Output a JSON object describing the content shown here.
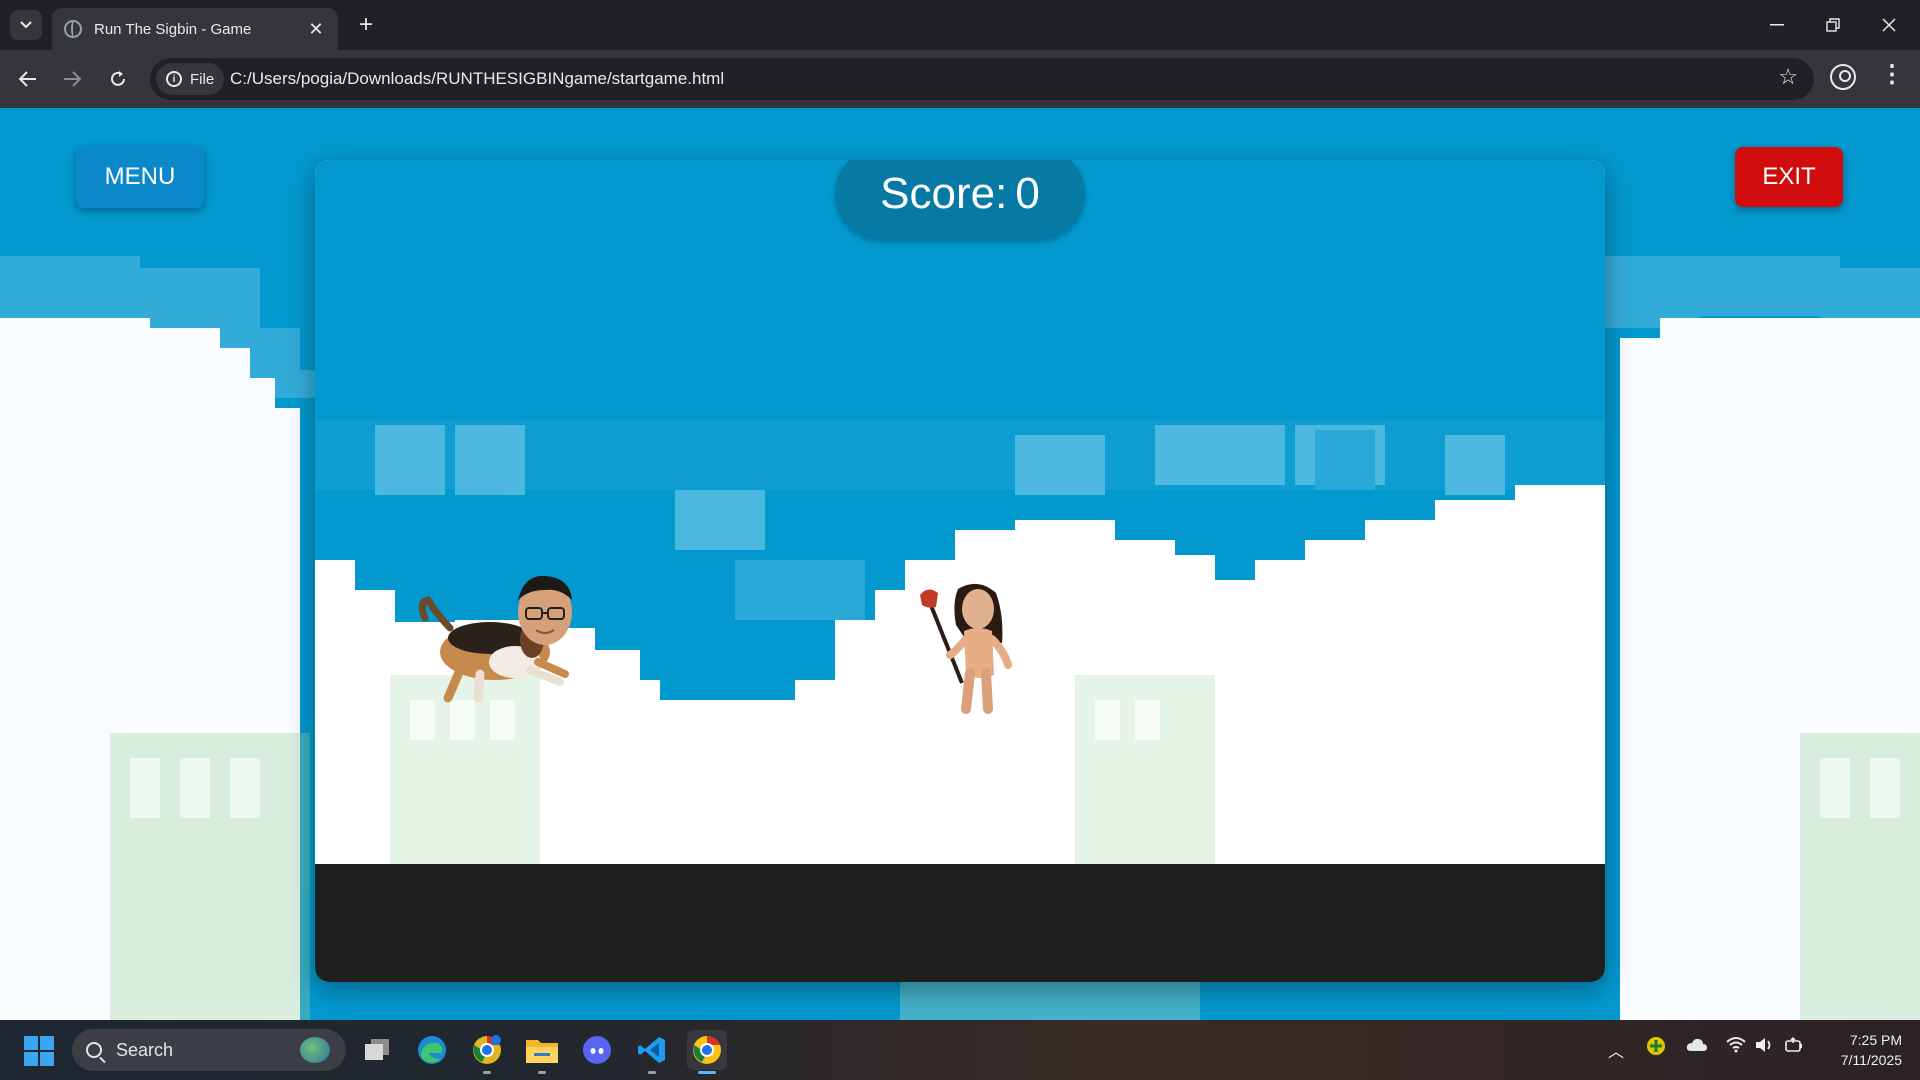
{
  "browser": {
    "tab_title": "Run The Sigbin - Game",
    "chip_label": "File",
    "url": "C:/Users/pogia/Downloads/RUNTHESIGBINgame/startgame.html"
  },
  "game": {
    "menu_label": "MENU",
    "exit_label": "EXIT",
    "score_label": "Score:",
    "score_value": "0",
    "player": "dog-with-face",
    "enemy": "person-with-axe"
  },
  "taskbar": {
    "search_placeholder": "Search",
    "time": "7:25 PM",
    "date": "7/11/2025",
    "apps": [
      "file-explorer-multitask",
      "edge",
      "chrome-canary",
      "file-explorer",
      "discord",
      "vscode",
      "chrome"
    ]
  },
  "colors": {
    "sky": "#0399cf",
    "menu_button": "#0b88c9",
    "exit_button": "#d00c0c",
    "score_pill": "#0679a4",
    "ground": "#1f1f1f"
  }
}
